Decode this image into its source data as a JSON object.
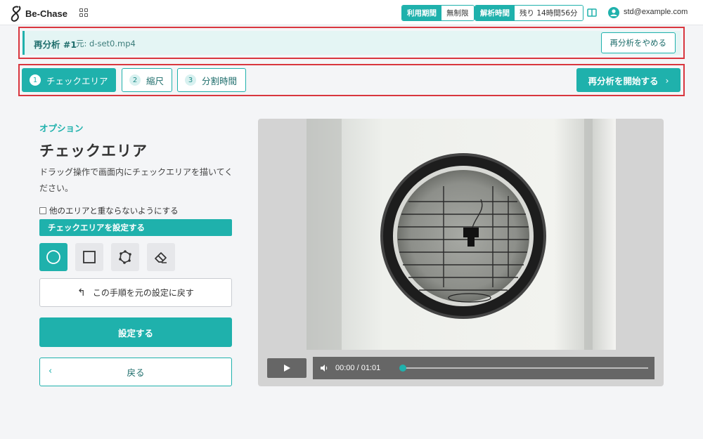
{
  "header": {
    "logo_text": "Be-Chase",
    "usage_period_label": "利用期間",
    "usage_period_value": "無制限",
    "analysis_time_label": "解析時間",
    "analysis_time_value": "残り 14時間56分",
    "user_email": "std@example.com"
  },
  "reanalysis": {
    "title": "再分析 #1",
    "source": "元: d-set0.mp4",
    "stop_button": "再分析をやめる"
  },
  "steps": {
    "items": [
      {
        "num": "1",
        "label": "チェックエリア",
        "active": true
      },
      {
        "num": "2",
        "label": "縮尺",
        "active": false
      },
      {
        "num": "3",
        "label": "分割時間",
        "active": false
      }
    ],
    "start_button": "再分析を開始する",
    "start_chevron": "›"
  },
  "panel": {
    "section_label": "オプション",
    "title": "チェックエリア",
    "description": "ドラッグ操作で画面内にチェックエリアを描いてください。",
    "no_overlap_checkbox": "他のエリアと重ならないようにする",
    "no_overlap_checked": false,
    "set_area_label": "チェックエリアを設定する",
    "tools": [
      {
        "icon": "circle-icon",
        "active": true
      },
      {
        "icon": "square-icon",
        "active": false
      },
      {
        "icon": "polygon-icon",
        "active": false
      },
      {
        "icon": "eraser-icon",
        "active": false
      }
    ],
    "reset_button": "この手順を元の設定に戻す",
    "set_button": "設定する",
    "back_button": "戻る",
    "back_chevron": "‹"
  },
  "video": {
    "time": "00:00 / 01:01",
    "progress": 0
  },
  "colors": {
    "accent": "#1fb1ac",
    "highlight_border": "#d9363e"
  }
}
